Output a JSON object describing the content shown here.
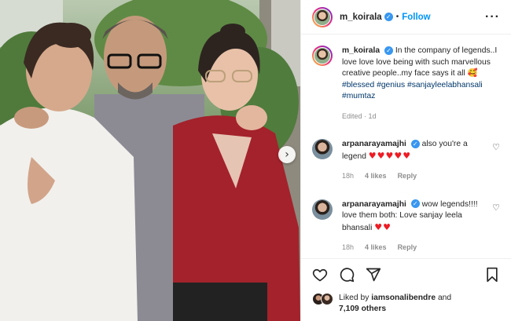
{
  "header": {
    "username": "m_koirala",
    "separator": "•",
    "follow_label": "Follow",
    "more_label": "···"
  },
  "caption": {
    "username": "m_koirala",
    "text": "In the company of legends..I love love love being with such marvellous creative people..my face says it all 🥰",
    "hashtags": [
      "#blessed",
      "#genius",
      "#sanjayleelabhansali",
      "#mumtaz"
    ],
    "meta": "Edited · 1d"
  },
  "comments": [
    {
      "username": "arpanarayamajhi",
      "text": "also you're a legend",
      "emoji": "♥♥♥♥♥",
      "time": "18h",
      "likes": "4 likes",
      "reply_label": "Reply"
    },
    {
      "username": "arpanarayamajhi",
      "text": "wow legends!!!! love them both: Love sanjay leela bhansali",
      "emoji": "♥♥",
      "time": "18h",
      "likes": "4 likes",
      "reply_label": "Reply"
    }
  ],
  "likes": {
    "prefix": "Liked by",
    "user": "iamsonalibendre",
    "and": "and",
    "others": "7,109 others"
  },
  "icons": {
    "verified": "verified-badge-icon",
    "like": "heart-icon",
    "comment": "comment-bubble-icon",
    "share": "paper-plane-icon",
    "save": "bookmark-icon",
    "next": "chevron-right-icon"
  },
  "colors": {
    "accent": "#0095f6",
    "verified": "#3897f0",
    "heart_emoji": "#ed1c24",
    "hashtag": "#00376b"
  }
}
